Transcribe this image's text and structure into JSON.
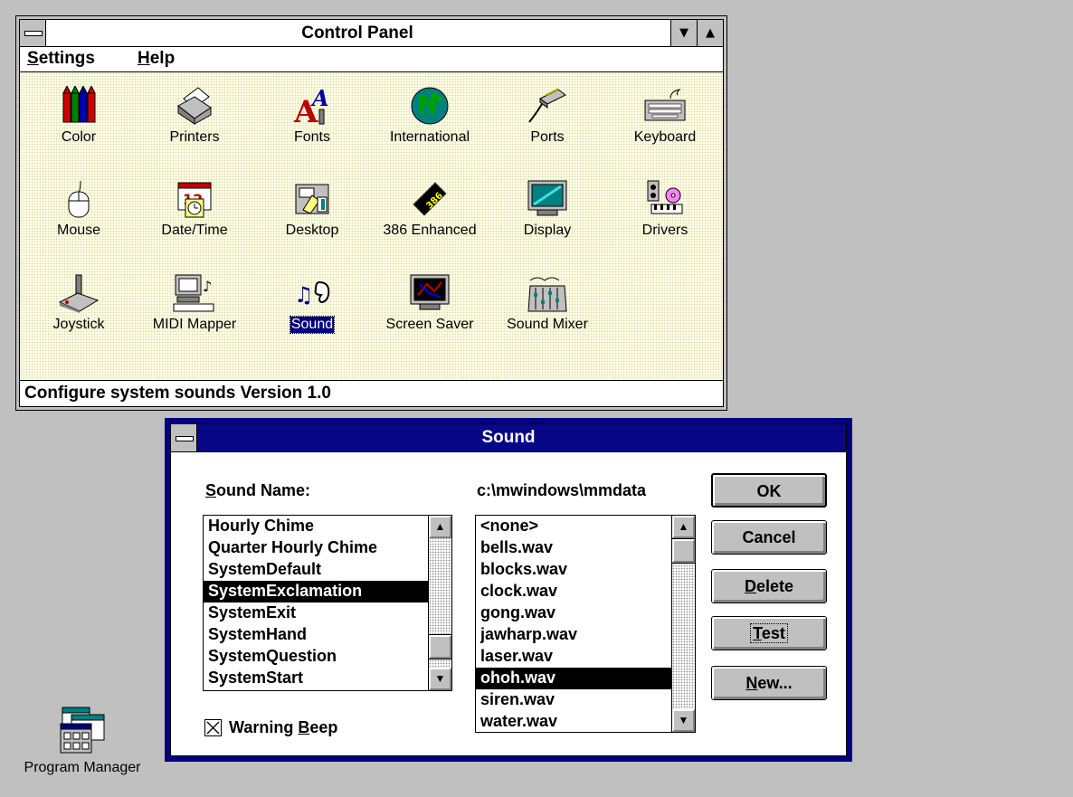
{
  "control_panel": {
    "title": "Control Panel",
    "menu": [
      {
        "label_u": "S",
        "label_rest": "ettings"
      },
      {
        "label_u": "H",
        "label_rest": "elp"
      }
    ],
    "icons": [
      {
        "label": "Color",
        "icon": "color-icon"
      },
      {
        "label": "Printers",
        "icon": "printers-icon"
      },
      {
        "label": "Fonts",
        "icon": "fonts-icon"
      },
      {
        "label": "International",
        "icon": "international-icon"
      },
      {
        "label": "Ports",
        "icon": "ports-icon"
      },
      {
        "label": "Keyboard",
        "icon": "keyboard-icon"
      },
      {
        "label": "Mouse",
        "icon": "mouse-icon"
      },
      {
        "label": "Date/Time",
        "icon": "date-time-icon"
      },
      {
        "label": "Desktop",
        "icon": "desktop-icon"
      },
      {
        "label": "386 Enhanced",
        "icon": "386-enhanced-icon"
      },
      {
        "label": "Display",
        "icon": "display-icon"
      },
      {
        "label": "Drivers",
        "icon": "drivers-icon"
      },
      {
        "label": "Joystick",
        "icon": "joystick-icon"
      },
      {
        "label": "MIDI Mapper",
        "icon": "midi-mapper-icon"
      },
      {
        "label": "Sound",
        "icon": "sound-icon",
        "selected": true
      },
      {
        "label": "Screen Saver",
        "icon": "screen-saver-icon"
      },
      {
        "label": "Sound Mixer",
        "icon": "sound-mixer-icon"
      }
    ],
    "status": "Configure system sounds Version 1.0"
  },
  "sound_dialog": {
    "title": "Sound",
    "sound_name_label": "Sound Name:",
    "path": "c:\\mwindows\\mmdata",
    "events": [
      "Hourly Chime",
      "Quarter Hourly Chime",
      "SystemDefault",
      "SystemExclamation",
      "SystemExit",
      "SystemHand",
      "SystemQuestion",
      "SystemStart"
    ],
    "selected_event": "SystemExclamation",
    "files": [
      "<none>",
      "bells.wav",
      "blocks.wav",
      "clock.wav",
      "gong.wav",
      "jawharp.wav",
      "laser.wav",
      "ohoh.wav",
      "siren.wav",
      "water.wav"
    ],
    "selected_file": "ohoh.wav",
    "warning_beep": {
      "label_pre": "Warning ",
      "label_u": "B",
      "label_rest": "eep",
      "checked": true
    },
    "buttons": {
      "ok": "OK",
      "cancel": "Cancel",
      "delete_u": "D",
      "delete_rest": "elete",
      "test_u": "T",
      "test_rest": "est",
      "new_u": "N",
      "new_rest": "ew..."
    }
  },
  "desktop": {
    "program_manager_label": "Program Manager"
  },
  "colors": {
    "desktop": "#c0c0c0",
    "active_title": "#000080",
    "selection": "#000080"
  }
}
